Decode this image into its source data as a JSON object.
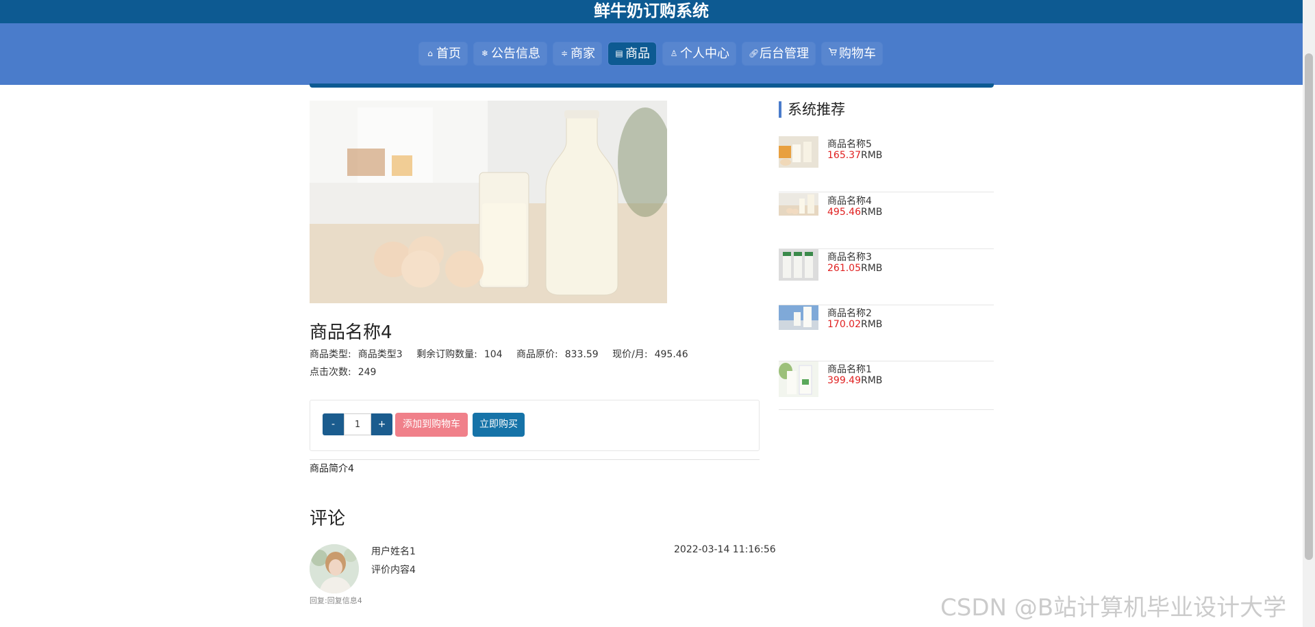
{
  "header": {
    "site_title": "鲜牛奶订购系统"
  },
  "nav": {
    "items": [
      {
        "label": "首页",
        "icon": "home-icon"
      },
      {
        "label": "公告信息",
        "icon": "snowflake-icon"
      },
      {
        "label": "商家",
        "icon": "sliders-icon"
      },
      {
        "label": "商品",
        "icon": "document-icon",
        "active": true
      },
      {
        "label": "个人中心",
        "icon": "user-icon"
      },
      {
        "label": "后台管理",
        "icon": "link-icon"
      },
      {
        "label": "购物车",
        "icon": "cart-icon"
      }
    ]
  },
  "product": {
    "name": "商品名称4",
    "type_label": "商品类型:",
    "type_value": "商品类型3",
    "stock_label": "剩余订购数量:",
    "stock_value": "104",
    "orig_price_label": "商品原价:",
    "orig_price_value": "833.59",
    "price_label": "现价/月:",
    "price_value": "495.46",
    "clicks_label": "点击次数:",
    "clicks_value": "249",
    "intro": "商品简介4"
  },
  "purchase": {
    "minus": "-",
    "quantity": "1",
    "plus": "+",
    "add_to_cart": "添加到购物车",
    "buy_now": "立即购买"
  },
  "comments": {
    "title": "评论",
    "items": [
      {
        "user": "用户姓名1",
        "content": "评价内容4",
        "time": "2022-03-14 11:16:56",
        "reply": "回复:回复信息4"
      }
    ]
  },
  "sidebar": {
    "title": "系统推荐",
    "items": [
      {
        "name": "商品名称5",
        "price": "165.37",
        "unit": "RMB"
      },
      {
        "name": "商品名称4",
        "price": "495.46",
        "unit": "RMB"
      },
      {
        "name": "商品名称3",
        "price": "261.05",
        "unit": "RMB"
      },
      {
        "name": "商品名称2",
        "price": "170.02",
        "unit": "RMB"
      },
      {
        "name": "商品名称1",
        "price": "399.49",
        "unit": "RMB"
      }
    ]
  },
  "watermark": "CSDN @B站计算机毕业设计大学",
  "colors": {
    "header_dark": "#0d5a92",
    "nav_blue": "#4a7ccb",
    "price_red": "#e02020",
    "cart_button": "#f0808a",
    "buy_button": "#1673a8"
  }
}
